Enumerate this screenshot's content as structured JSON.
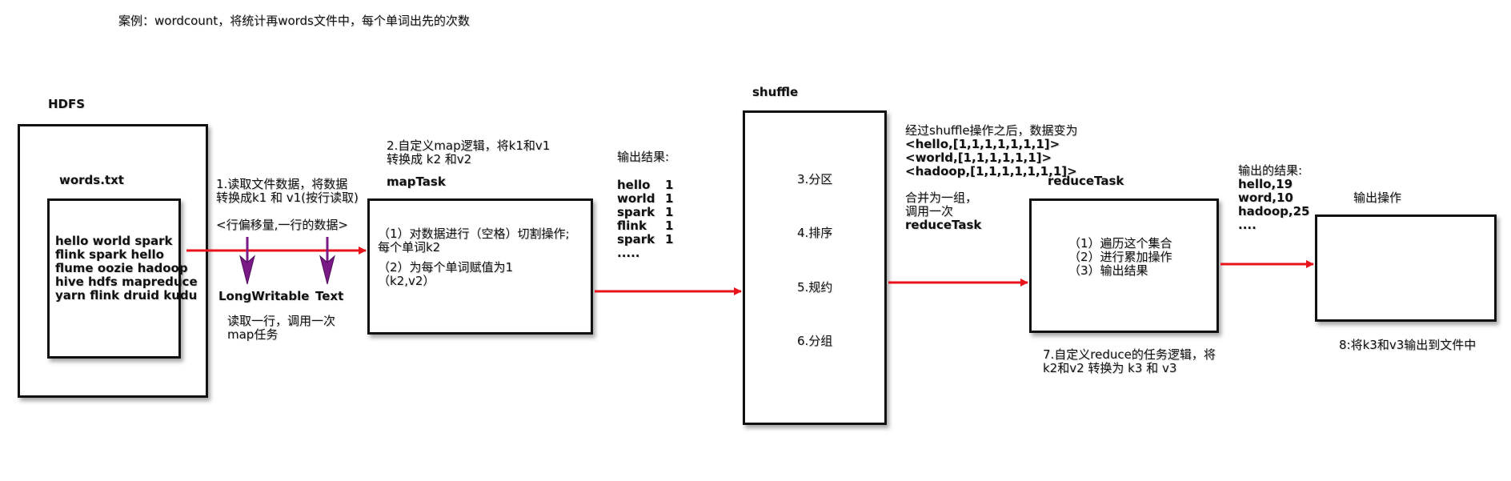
{
  "title": "案例：wordcount，将统计再words文件中，每个单词出先的次数",
  "hdfs": {
    "label": "HDFS",
    "file_label": "words.txt",
    "lines": [
      "hello world  spark",
      "flink spark  hello",
      "flume oozie  hadoop",
      "hive  hdfs  mapreduce",
      "yarn  flink druid  kudu"
    ]
  },
  "step1": {
    "lines": [
      "1.读取文件数据，将数据",
      "转换成k1 和 v1(按行读取)"
    ],
    "format": "<行偏移量,一行的数据>",
    "k_type": "LongWritable",
    "v_type": "Text",
    "note_lines": [
      "读取一行，调用一次",
      "map任务"
    ]
  },
  "step2": {
    "lines": [
      "2.自定义map逻辑，将k1和v1",
      "转换成 k2 和v2"
    ],
    "task_label": "mapTask",
    "ops": [
      "（1）对数据进行（空格）切割操作;",
      "每个单词k2",
      "（2）为每个单词赋值为1",
      "（k2,v2）"
    ]
  },
  "map_output": {
    "header": "输出结果:",
    "rows": [
      {
        "word": "hello",
        "count": "1"
      },
      {
        "word": "world",
        "count": "1"
      },
      {
        "word": "spark",
        "count": "1"
      },
      {
        "word": "flink",
        "count": "1"
      },
      {
        "word": "spark",
        "count": "1"
      }
    ],
    "more": "....."
  },
  "shuffle": {
    "label": "shuffle",
    "steps": [
      "3.分区",
      "4.排序",
      "5.规约",
      "6.分组"
    ]
  },
  "after_shuffle": {
    "lines": [
      "经过shuffle操作之后，数据变为",
      "<hello,[1,1,1,1,1,1,1]>",
      "<world,[1,1,1,1,1,1]>",
      "<hadoop,[1,1,1,1,1,1,1]>"
    ],
    "merge_lines": [
      "合并为一组，",
      "调用一次",
      "reduceTask"
    ]
  },
  "reduce": {
    "task_label": "reduceTask",
    "ops": [
      "（1）遍历这个集合",
      "（2）进行累加操作",
      "（3）输出结果"
    ],
    "step7_lines": [
      "7.自定义reduce的任务逻辑，将",
      "k2和v2 转换为 k3 和 v3"
    ]
  },
  "reduce_output": {
    "header": "输出的结果:",
    "rows": [
      "hello,19",
      "word,10",
      "hadoop,25",
      "...."
    ]
  },
  "output_op": {
    "label": "输出操作",
    "step8": "8:将k3和v3输出到文件中"
  },
  "colors": {
    "arrow": "#e8141b",
    "type_arrow": "#7a1a86",
    "border": "#111111"
  }
}
